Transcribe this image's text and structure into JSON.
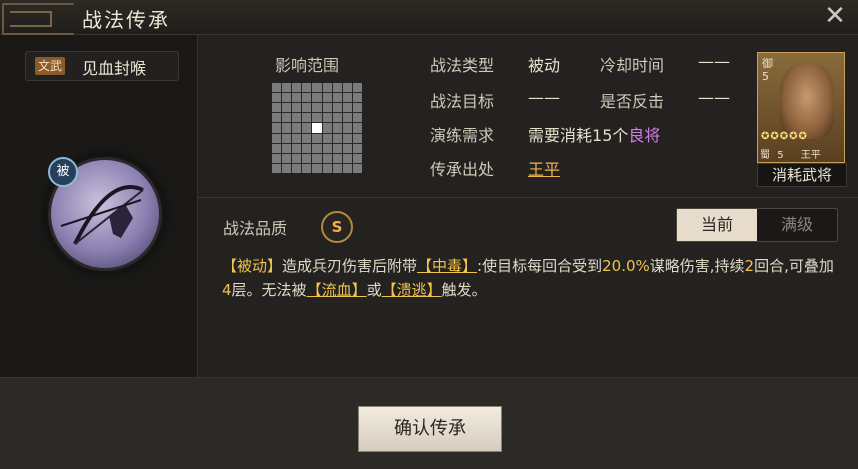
{
  "window": {
    "title": "战法传承",
    "close_icon": "close-icon"
  },
  "skill": {
    "type_badge": "文武",
    "name": "见血封喉",
    "passive_badge": "被"
  },
  "range": {
    "title": "影响范围",
    "grid_size": 9
  },
  "info": {
    "type_label": "战法类型",
    "type_value": "被动",
    "cooldown_label": "冷却时间",
    "cooldown_value": "——",
    "target_label": "战法目标",
    "target_value": "——",
    "counter_label": "是否反击",
    "counter_value": "——",
    "require_label": "演练需求",
    "require_value_pre": "需要消耗",
    "require_count": "15个",
    "require_item": "良将",
    "source_label": "传承出处",
    "source_value": "王平"
  },
  "general": {
    "class": "御",
    "level": "5",
    "stars": "✪✪✪✪✪",
    "faction": "蜀",
    "rank": "5",
    "name": "王平",
    "caption": "消耗武将"
  },
  "quality": {
    "label": "战法品质",
    "grade": "S"
  },
  "toggle": {
    "current": "当前",
    "max": "满级"
  },
  "description": {
    "tag_passive": "【被动】",
    "part1": "造成兵刃伤害后附带",
    "tag_poison": "【中毒】",
    "part2": ":使目标每回合受到",
    "percent": "20.0%",
    "part3": "谋略伤害,持续",
    "rounds": "2",
    "part4": "回合,可叠加",
    "stacks": "4",
    "part5": "层。无法被",
    "tag_bleed": "【流血】",
    "part6": "或",
    "tag_rout": "【溃逃】",
    "part7": "触发。"
  },
  "confirm_button": "确认传承"
}
